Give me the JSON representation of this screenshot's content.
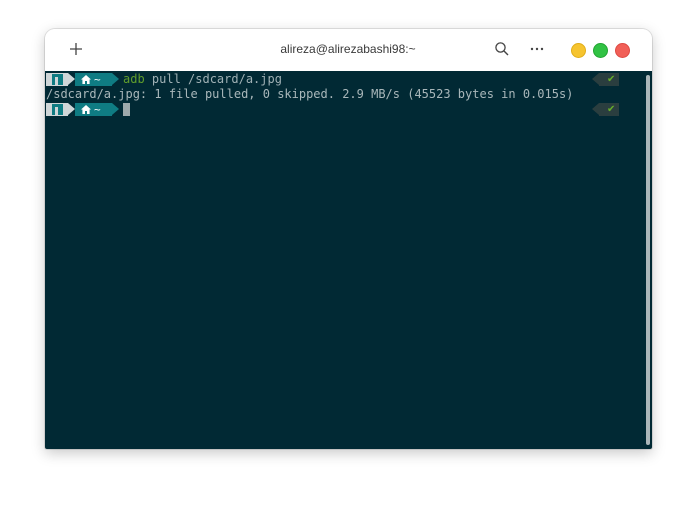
{
  "window": {
    "title": "alireza@alirezabashi98:~"
  },
  "headerbar": {
    "new_tab_icon": "plus-icon",
    "search_icon": "search-icon",
    "menu_icon": "ellipsis-icon",
    "controls": [
      "minimize",
      "maximize",
      "close"
    ]
  },
  "colors": {
    "terminal_bg": "#012934",
    "prompt_dir_bg": "#0f7c83",
    "prompt_os_bg": "#cfd6d8",
    "command_color": "#5f9d2c",
    "status_ok_color": "#65ad2a"
  },
  "terminal": {
    "prompt_dir": "~",
    "prompt_home_icon": "home-icon",
    "prompt_os_icon": "manjaro-icon",
    "lines": [
      {
        "type": "prompt",
        "command": "adb",
        "args": " pull /sdcard/a.jpg",
        "status": "✔"
      },
      {
        "type": "output",
        "text": "/sdcard/a.jpg: 1 file pulled, 0 skipped. 2.9 MB/s (45523 bytes in 0.015s)"
      },
      {
        "type": "prompt",
        "command": "",
        "args": "",
        "status": "✔"
      }
    ]
  }
}
